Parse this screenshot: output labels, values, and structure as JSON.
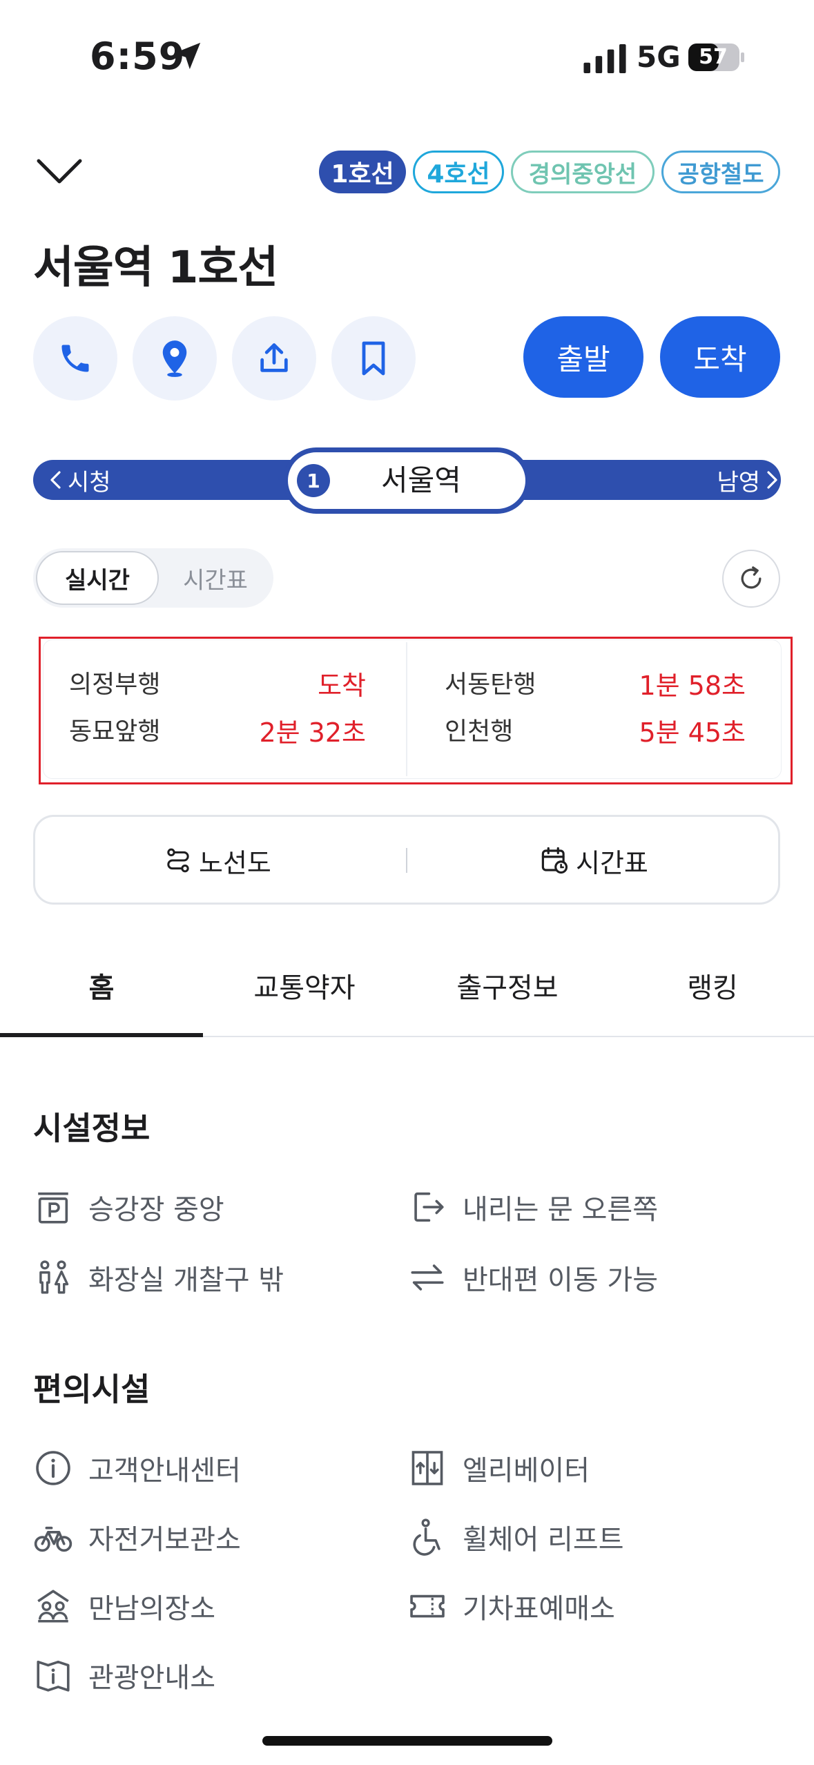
{
  "status_bar": {
    "time": "6:59",
    "network": "5G",
    "battery": "57"
  },
  "header": {
    "line_chips": [
      "1호선",
      "4호선",
      "경의중앙선",
      "공항철도"
    ],
    "title": "서울역 1호선"
  },
  "actions": {
    "departure": "출발",
    "arrival": "도착"
  },
  "station_bar": {
    "prev": "시청",
    "current": "서울역",
    "next": "남영",
    "line_number": "1"
  },
  "toggle": {
    "realtime": "실시간",
    "timetable": "시간표"
  },
  "realtime": [
    {
      "dest": "의정부행",
      "time": "도착"
    },
    {
      "dest": "동묘앞행",
      "time": "2분 32초"
    },
    {
      "dest": "서동탄행",
      "time": "1분 58초"
    },
    {
      "dest": "인천행",
      "time": "5분 45초"
    }
  ],
  "map_buttons": {
    "route_map": "노선도",
    "timetable": "시간표"
  },
  "tabs": [
    "홈",
    "교통약자",
    "출구정보",
    "랭킹"
  ],
  "facility_info": {
    "title": "시설정보",
    "items": [
      "승강장 중앙",
      "내리는 문 오른쪽",
      "화장실 개찰구 밖",
      "반대편 이동 가능"
    ]
  },
  "convenience": {
    "title": "편의시설",
    "items": [
      "고객안내센터",
      "엘리베이터",
      "자전거보관소",
      "휠체어 리프트",
      "만남의장소",
      "기차표예매소",
      "관광안내소"
    ]
  },
  "colors": {
    "line1": "#2e4fae",
    "accent": "#1f63e6",
    "alert": "#e0202a"
  }
}
